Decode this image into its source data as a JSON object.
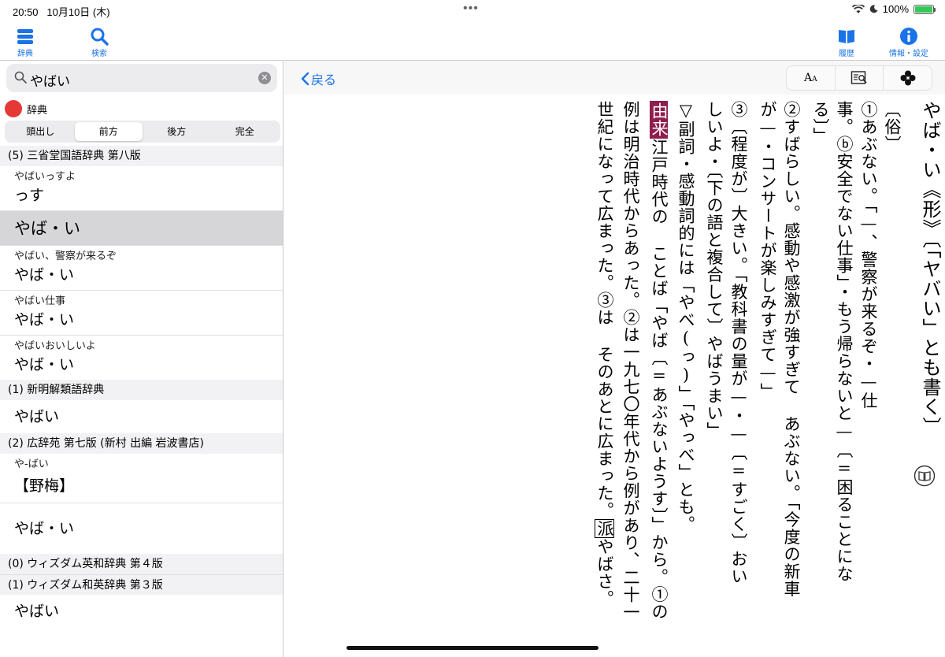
{
  "status": {
    "time": "20:50",
    "date": "10月10日 (木)",
    "battery_pct": "100%",
    "battery_level": 1.0
  },
  "toolbar": {
    "dictionary_label": "辞典",
    "search_label": "検索",
    "history_label": "履歴",
    "info_label": "情報・設定"
  },
  "search": {
    "value": "やばい",
    "clear_icon": "x-circle-icon"
  },
  "dict_tag_label": "辞典",
  "segments": [
    "頭出し",
    "前方",
    "後方",
    "完全"
  ],
  "active_segment": 1,
  "results": {
    "group1": "(5) 三省堂国語辞典 第八版",
    "g1_items": [
      {
        "sub": "やばいっすよ",
        "main": "っす"
      },
      {
        "sub": "",
        "main": "やば・い"
      },
      {
        "sub": "やばい、警察が来るぞ",
        "main": "やば・い"
      },
      {
        "sub": "やばい仕事",
        "main": "やば・い"
      },
      {
        "sub": "やばいおいしいよ",
        "main": "やば・い"
      }
    ],
    "group2": "(1) 新明解類語辞典",
    "g2_items": [
      {
        "main": "やばい"
      }
    ],
    "group3": "(2) 広辞苑 第七版 (新村 出編 岩波書店)",
    "g3_items": [
      {
        "sub": "や‐ばい",
        "main": "【野梅】"
      },
      {
        "main": "やば・い"
      }
    ],
    "group4": "(0) ウィズダム英和辞典 第４版",
    "group5": "(1) ウィズダム和英辞典 第３版",
    "g5_items": [
      {
        "main": "やばい"
      }
    ]
  },
  "navbar": {
    "back_label": "戻る",
    "font_size_tool": "AA",
    "lookup_tool_icon": "book-search-icon",
    "more_tool_icon": "clover-icon"
  },
  "entry": {
    "col1": "やば・い《形》〔「ヤバい」とも書く〕",
    "col2": "〔俗〕",
    "col3": "①あぶない。「—、警察が来るぞ・—仕",
    "col4": "事。ⓑ安全でない仕事」・もう帰らないと—〔=困ることにな",
    "col5": "る〕」",
    "col6": "②すばらしい。感動や感激が強すぎて あぶない。「今度の新車",
    "col7": "が—・コンサートが楽しみすぎて—」",
    "col8": "③〔程度が〕大きい。「教科書の量が—・—〔=すごく〕おい",
    "col9": "しいよ・〔下の語と複合して〕やばうまい」",
    "col10": "▽副詞・感動詞的には「やべ(っ)」「やっべ」とも。",
    "col11_badge": "由来",
    "col11": "江戸時代の ことば「やば〔=あぶないようす〕」から。①の",
    "col12": "例は明治時代からあった。②は一九七〇年代から例があり、二十一",
    "col13": "世紀になって広まった。③は そのあとに広まった。",
    "col13_box": "派",
    "col13_tail": "やばさ。"
  },
  "colors": {
    "accent": "#1a73e8",
    "badge": "#8e1e4e",
    "red_dot": "#e53935"
  }
}
